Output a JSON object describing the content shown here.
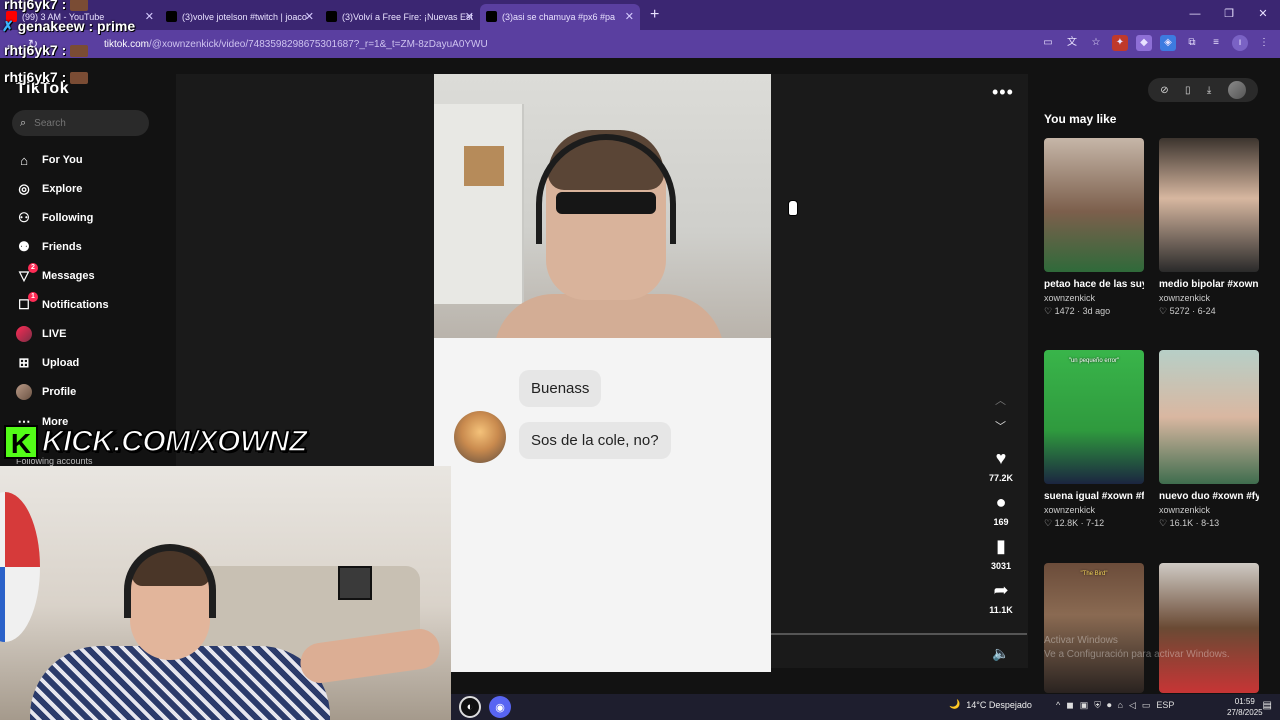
{
  "browser": {
    "tabs": [
      {
        "label": "(99) 3 AM - YouTube",
        "favicon_color": "#ff0000",
        "active": false
      },
      {
        "label": "(3)volve jotelson #twitch | joaco",
        "favicon_color": "#000000",
        "active": false
      },
      {
        "label": "(3)Volví a Free Fire: ¡Nuevas Est",
        "favicon_color": "#000000",
        "active": false
      },
      {
        "label": "(3)asi se chamuya #px6 #pa",
        "favicon_color": "#000000",
        "active": true
      }
    ],
    "new_tab_icon": "plus-icon",
    "url_host": "tiktok.com",
    "url_path": "/@xownzenkick/video/7483598298675301687?_r=1&_t=ZM-8zDayuA0YWU"
  },
  "stream_chat": [
    {
      "user": "rhtj6yk7 :",
      "text": ""
    },
    {
      "user": "genakeew :",
      "text": "prime"
    },
    {
      "user": "rhtj6yk7 :",
      "text": ""
    },
    {
      "user": "rhtj6yk7 :",
      "text": ""
    }
  ],
  "kick_banner": {
    "letter": "K",
    "text": "KICK.COM/XOWNZ",
    "color": "#53fc18"
  },
  "tiktok": {
    "logo": "TikTok",
    "search_placeholder": "Search",
    "nav": [
      {
        "label": "For You",
        "icon": "home-icon"
      },
      {
        "label": "Explore",
        "icon": "compass-icon"
      },
      {
        "label": "Following",
        "icon": "following-icon"
      },
      {
        "label": "Friends",
        "icon": "friends-icon"
      },
      {
        "label": "Messages",
        "icon": "messages-icon",
        "badge": "2"
      },
      {
        "label": "Notifications",
        "icon": "inbox-icon",
        "badge": "1"
      },
      {
        "label": "LIVE",
        "icon": "live-icon"
      },
      {
        "label": "Upload",
        "icon": "upload-icon"
      },
      {
        "label": "Profile",
        "icon": "profile-avatar"
      },
      {
        "label": "More",
        "icon": "more-icon"
      }
    ],
    "following_accounts": "Following accounts",
    "video_chat": {
      "msg1": "Buenass",
      "msg2": "Sos de la cole, no?"
    },
    "actions": {
      "likes": "77.2K",
      "comments": "169",
      "saves": "3031",
      "shares": "11.1K"
    },
    "recommend_title": "You may like",
    "recommendations": [
      {
        "title": "petao hace de las suyas #xown #fyp...",
        "user": "xownzenkick",
        "likes": "1472",
        "date": "3d ago",
        "caption": ""
      },
      {
        "title": "medio bipolar #xown #fyp #clips #xown...",
        "user": "xownzenkick",
        "likes": "5272",
        "date": "6-24",
        "caption": ""
      },
      {
        "title": "suena igual #xown #fyp #clips #xown...",
        "user": "xownzenkick",
        "likes": "12.8K",
        "date": "7-12",
        "caption": "\"un pequeño error\""
      },
      {
        "title": "nuevo duo #xown #fyp #clips #xown...",
        "user": "xownzenkick",
        "likes": "16.1K",
        "date": "8-13",
        "caption": ""
      },
      {
        "title": "",
        "user": "",
        "likes": "",
        "date": "",
        "caption": "\"The Bird\""
      },
      {
        "title": "",
        "user": "",
        "likes": "",
        "date": "",
        "caption": ""
      }
    ],
    "watermark_line1": "Activar Windows",
    "watermark_line2": "Ve a Configuración para activar Windows."
  },
  "taskbar": {
    "weather": "14°C  Despejado",
    "lang": "ESP",
    "time": "01:59",
    "date": "27/8/2025"
  }
}
